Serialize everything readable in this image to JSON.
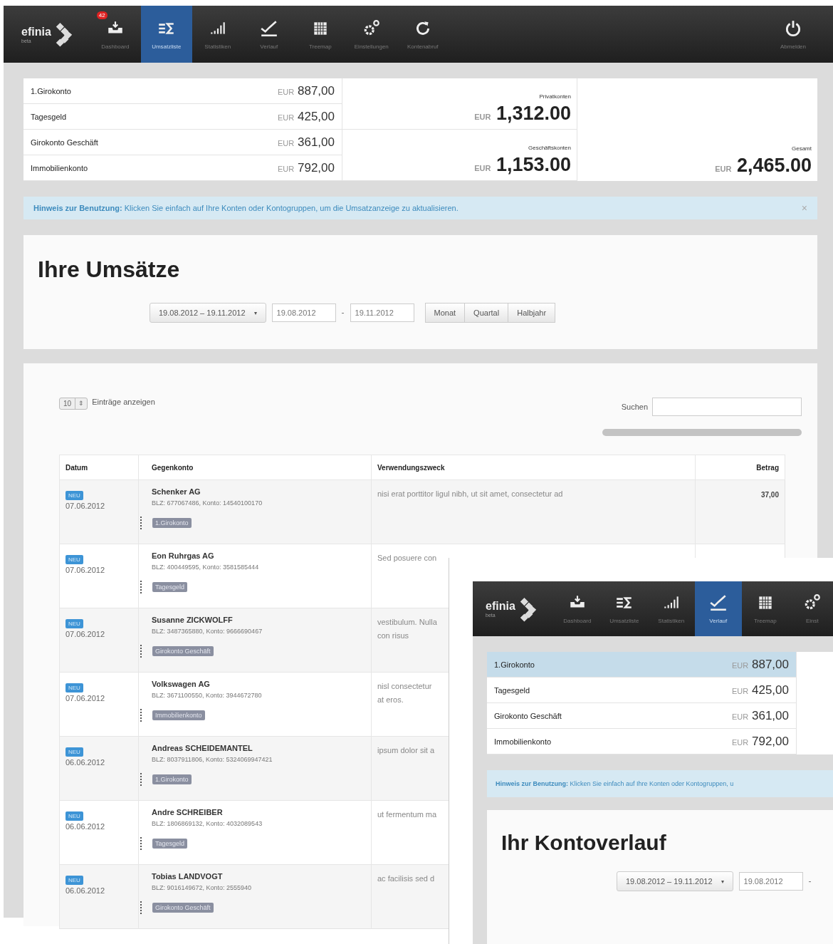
{
  "nav": {
    "logo": "efinia",
    "logo_sub": "beta",
    "items": [
      {
        "kind": "dashboard",
        "label": "Dashboard",
        "badge": "42",
        "selected": false
      },
      {
        "kind": "sum",
        "label": "Umsatzliste",
        "selected": true
      },
      {
        "kind": "stats",
        "label": "Statistiken",
        "selected": false
      },
      {
        "kind": "trend",
        "label": "Verlauf",
        "selected": false
      },
      {
        "kind": "treemap",
        "label": "Treemap",
        "selected": false
      },
      {
        "kind": "settings",
        "label": "Einstellungen",
        "selected": false
      },
      {
        "kind": "refresh",
        "label": "Kontenabruf",
        "selected": false
      }
    ],
    "logout": {
      "label": "Abmelden"
    }
  },
  "accounts": [
    {
      "name": "1.Girokonto",
      "currency": "EUR",
      "amount": "887,00",
      "selected": false
    },
    {
      "name": "Tagesgeld",
      "currency": "EUR",
      "amount": "425,00",
      "selected": false
    },
    {
      "name": "Girokonto Geschäft",
      "currency": "EUR",
      "amount": "361,00",
      "selected": false
    },
    {
      "name": "Immobilienkonto",
      "currency": "EUR",
      "amount": "792,00",
      "selected": false
    }
  ],
  "groups": [
    {
      "label": "Privatkonten",
      "currency": "EUR",
      "amount": "1,312.00"
    },
    {
      "label": "Geschäftskonten",
      "currency": "EUR",
      "amount": "1,153.00"
    }
  ],
  "total": {
    "label": "Gesamt",
    "currency": "EUR",
    "amount": "2,465.00"
  },
  "hint": {
    "lead": "Hinweis zur Benutzung:",
    "text": "Klicken Sie einfach auf Ihre Konten oder Kontogruppen, um die Umsatzanzeige zu aktualisieren.",
    "close": "×"
  },
  "sales": {
    "title": "Ihre Umsätze",
    "range": "19.08.2012 – 19.11.2012",
    "caret": "▾",
    "from": "19.08.2012",
    "separator": "-",
    "to": "19.11.2012",
    "periods": [
      "Monat",
      "Quartal",
      "Halbjahr"
    ]
  },
  "table": {
    "page_size": "10",
    "page_size_arrows": "⇕",
    "page_size_label": "Einträge anzeigen",
    "search_label": "Suchen",
    "columns": [
      "Datum",
      "Gegenkonto",
      "Verwendungszweck",
      "Betrag"
    ],
    "rows": [
      {
        "badge": "NEU",
        "date": "07.06.2012",
        "name": "Schenker AG",
        "bank": "BLZ: 677067486, Konto: 14540100170",
        "tag": "1.Girokonto",
        "purpose": [
          "nisi erat porttitor ligul nibh, ut sit amet, consectetur ad"
        ],
        "amount": "37,00"
      },
      {
        "badge": "NEU",
        "date": "07.06.2012",
        "name": "Eon Ruhrgas AG",
        "bank": "BLZ: 400449595, Konto: 3581585444",
        "tag": "Tagesgeld",
        "purpose": [
          "Sed posuere con"
        ]
      },
      {
        "badge": "NEU",
        "date": "07.06.2012",
        "name": "Susanne ZICKWOLFF",
        "bank": "BLZ: 3487365880, Konto: 9666690467",
        "tag": "Girokonto Geschäft",
        "purpose": [
          "vestibulum. Nulla",
          "con risus"
        ]
      },
      {
        "badge": "NEU",
        "date": "07.06.2012",
        "name": "Volkswagen AG",
        "bank": "BLZ: 3671100550, Konto: 3944672780",
        "tag": "Immobilienkonto",
        "purpose": [
          "nisl consectetur",
          "at eros."
        ]
      },
      {
        "badge": "NEU",
        "date": "06.06.2012",
        "name": "Andreas SCHEIDEMANTEL",
        "bank": "BLZ: 8037911806, Konto: 5324069947421",
        "tag": "1.Girokonto",
        "purpose": [
          "ipsum dolor sit a"
        ]
      },
      {
        "badge": "NEU",
        "date": "06.06.2012",
        "name": "Andre SCHREIBER",
        "bank": "BLZ: 1806869132, Konto: 4032089543",
        "tag": "Tagesgeld",
        "purpose": [
          "ut fermentum ma"
        ]
      },
      {
        "badge": "NEU",
        "date": "06.06.2012",
        "name": "Tobias LANDVOGT",
        "bank": "BLZ: 9016149672, Konto: 2555940",
        "tag": "Girokonto Geschäft",
        "purpose": [
          "ac facilisis sed d"
        ]
      }
    ]
  },
  "overlay": {
    "logo": "efinia",
    "logo_sub": "beta",
    "items": [
      {
        "kind": "dashboard",
        "label": "Dashboard",
        "selected": false
      },
      {
        "kind": "sum",
        "label": "Umsatzliste",
        "selected": false
      },
      {
        "kind": "stats",
        "label": "Statistiken",
        "selected": false
      },
      {
        "kind": "trend",
        "label": "Verlauf",
        "selected": true
      },
      {
        "kind": "treemap",
        "label": "Treemap",
        "selected": false
      },
      {
        "kind": "settings",
        "label": "Einst",
        "selected": false
      }
    ],
    "accounts": [
      {
        "name": "1.Girokonto",
        "currency": "EUR",
        "amount": "887,00",
        "selected": true
      },
      {
        "name": "Tagesgeld",
        "currency": "EUR",
        "amount": "425,00",
        "selected": false
      },
      {
        "name": "Girokonto Geschäft",
        "currency": "EUR",
        "amount": "361,00",
        "selected": false
      },
      {
        "name": "Immobilienkonto",
        "currency": "EUR",
        "amount": "792,00",
        "selected": false
      }
    ],
    "hint": {
      "lead": "Hinweis zur Benutzung:",
      "text": "Klicken Sie einfach auf Ihre Konten oder Kontogruppen, u"
    },
    "title": "Ihr Kontoverlauf",
    "range": "19.08.2012 – 19.11.2012",
    "caret": "▾",
    "from": "19.08.2012",
    "separator": "-"
  }
}
